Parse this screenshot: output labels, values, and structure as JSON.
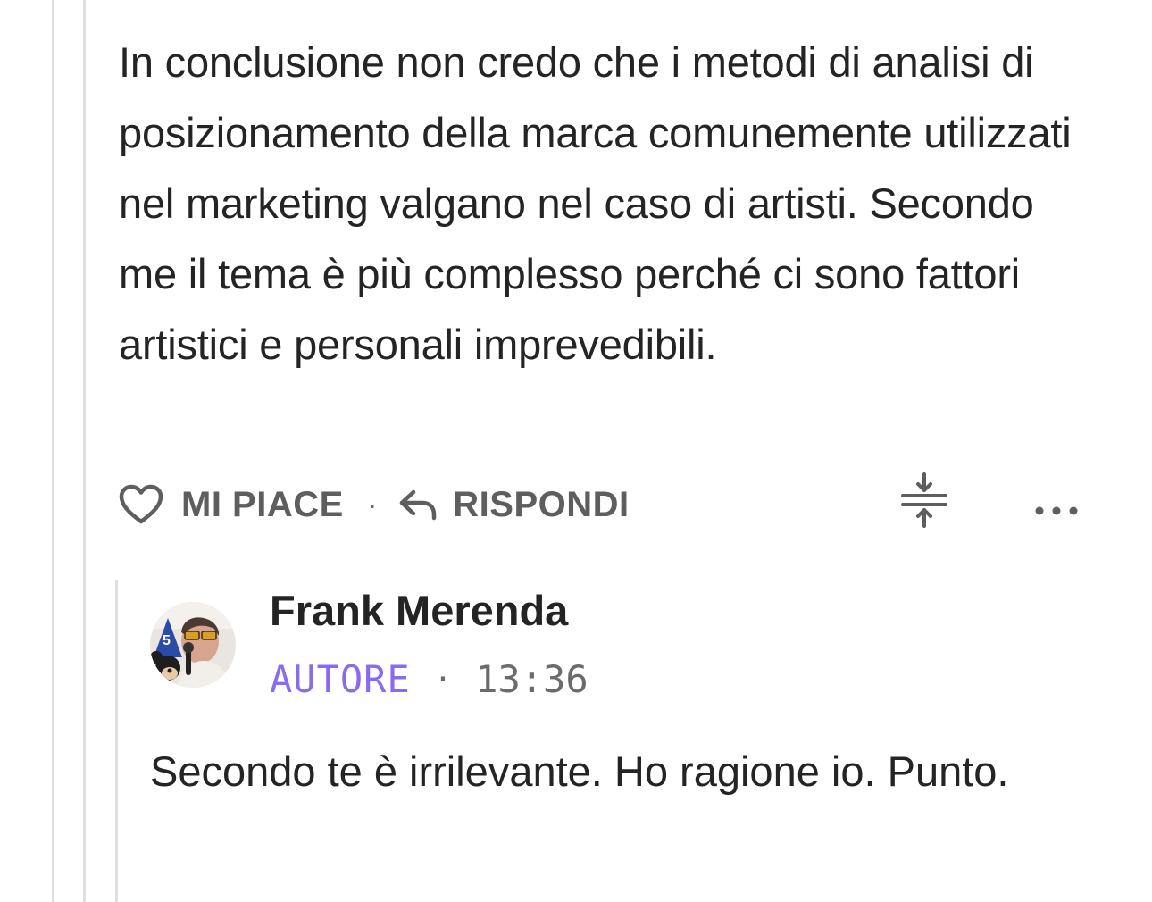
{
  "comment": {
    "body": "In conclusione non credo che i metodi di analisi di posizionamento della marca comunemente utilizzati nel marketing valgano nel caso di artisti. Secondo me il tema è più complesso perché ci sono fattori artistici e personali imprevedibili.",
    "actions": {
      "like_label": "MI PIACE",
      "separator": "·",
      "reply_label": "RISPONDI"
    }
  },
  "reply": {
    "author_name": "Frank Merenda",
    "badge": "AUTORE",
    "separator": "·",
    "time": "13:36",
    "body": "Secondo te è irrilevante. Ho ragione io. Punto."
  },
  "icons": {
    "like": "heart-outline-icon",
    "reply": "reply-arrow-icon",
    "collapse": "collapse-thread-icon",
    "more": "more-dots-icon"
  },
  "colors": {
    "text": "#242424",
    "muted": "#5e5e5e",
    "author_badge": "#8a6bf0",
    "thread_line": "#dedede"
  }
}
